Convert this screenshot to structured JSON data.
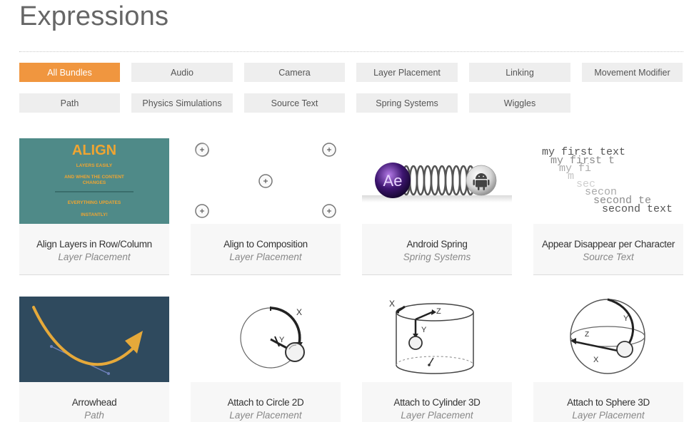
{
  "page": {
    "title": "Expressions"
  },
  "filters": [
    {
      "label": "All Bundles",
      "active": true
    },
    {
      "label": "Audio"
    },
    {
      "label": "Camera"
    },
    {
      "label": "Layer Placement"
    },
    {
      "label": "Linking"
    },
    {
      "label": "Movement Modifier"
    },
    {
      "label": "Path"
    },
    {
      "label": "Physics Simulations"
    },
    {
      "label": "Source Text"
    },
    {
      "label": "Spring Systems"
    },
    {
      "label": "Wiggles"
    }
  ],
  "cards": [
    {
      "title": "Align Layers in Row/Column",
      "category": "Layer Placement",
      "thumb": {
        "heading": "ALIGN",
        "line1": "LAYERS EASILY",
        "line2": "AND WHEN THE CONTENT",
        "line3": "CHANGES",
        "line4": "EVERYTHING UPDATES",
        "line5": "INSTANTLY!"
      }
    },
    {
      "title": "Align to Composition",
      "category": "Layer Placement"
    },
    {
      "title": "Android Spring",
      "category": "Spring Systems",
      "thumb": {
        "badge": "Ae"
      }
    },
    {
      "title": "Appear Disappear per Character",
      "category": "Source Text",
      "thumb": {
        "lines": [
          "my first text",
          "my first t",
          "my fi",
          "m",
          "sec",
          "secon",
          "second te",
          "second text"
        ]
      }
    },
    {
      "title": "Arrowhead",
      "category": "Path"
    },
    {
      "title": "Attach to Circle 2D",
      "category": "Layer Placement",
      "thumb": {
        "axis_x": "X",
        "axis_y": "Y"
      }
    },
    {
      "title": "Attach to Cylinder 3D",
      "category": "Layer Placement",
      "thumb": {
        "axis_x": "X",
        "axis_y": "Y",
        "axis_z": "Z"
      }
    },
    {
      "title": "Attach to Sphere 3D",
      "category": "Layer Placement",
      "thumb": {
        "axis_x": "X",
        "axis_y": "Y",
        "axis_z": "Z"
      }
    }
  ],
  "colors": {
    "accent": "#f0963f",
    "align_bg": "#4f8a88",
    "align_heading": "#f0a531",
    "arrow_bg": "#2f4a5e",
    "arrow_curve": "#e6a93a"
  },
  "icons": [
    "crosshair-icon",
    "ae-badge-icon",
    "android-icon",
    "arrowhead-icon"
  ]
}
